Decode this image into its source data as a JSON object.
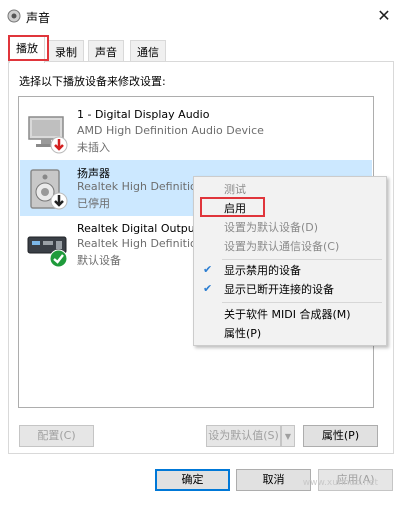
{
  "window": {
    "title": "声音",
    "close": "✕"
  },
  "tabs": [
    {
      "label": "播放",
      "active": true
    },
    {
      "label": "录制",
      "active": false
    },
    {
      "label": "声音",
      "active": false
    },
    {
      "label": "通信",
      "active": false
    }
  ],
  "instruction": "选择以下播放设备来修改设置:",
  "devices": [
    {
      "name": "1 - Digital Display Audio",
      "line1": "AMD High Definition Audio Device",
      "line2": "未插入",
      "status_icon": "red-down-arrow-icon"
    },
    {
      "name": "扬声器",
      "line1": "Realtek High Definition",
      "line2": "已停用",
      "status_icon": "black-down-arrow-icon"
    },
    {
      "name": "Realtek Digital Output",
      "line1": "Realtek High Definition",
      "line2": "默认设备",
      "status_icon": "green-check-icon"
    }
  ],
  "inner_buttons": {
    "configure": "配置(C)",
    "set_default": "设为默认值(S)",
    "properties": "属性(P)"
  },
  "bottom_buttons": {
    "ok": "确定",
    "cancel": "取消",
    "apply": "应用(A)"
  },
  "context_menu": {
    "items": [
      {
        "label": "测试",
        "disabled": true,
        "checked": false
      },
      {
        "label": "启用",
        "disabled": false,
        "checked": false
      },
      {
        "label": "设置为默认设备(D)",
        "disabled": true,
        "checked": false
      },
      {
        "label": "设置为默认通信设备(C)",
        "disabled": true,
        "checked": false
      },
      {
        "label": "显示禁用的设备",
        "disabled": false,
        "checked": true
      },
      {
        "label": "显示已断开连接的设备",
        "disabled": false,
        "checked": true
      },
      {
        "label": "关于软件 MIDI 合成器(M)",
        "disabled": false,
        "checked": false
      },
      {
        "label": "属性(P)",
        "disabled": false,
        "checked": false
      }
    ]
  },
  "watermark": "www.xunhuo.net",
  "colors": {
    "selection": "#cce8ff",
    "highlight_box": "#e0353b",
    "accent": "#0078d7"
  }
}
